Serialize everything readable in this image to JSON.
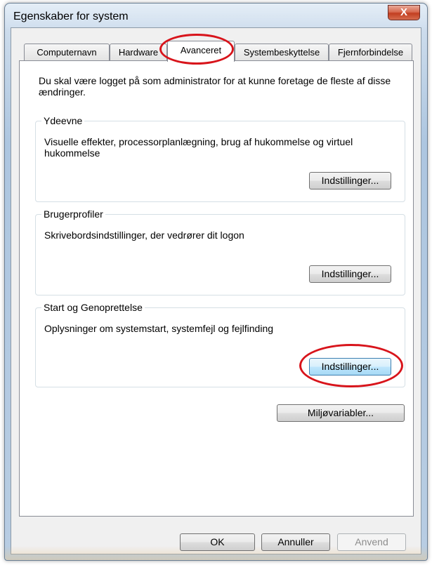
{
  "window": {
    "title": "Egenskaber for system",
    "close_glyph": "X"
  },
  "tabs": [
    {
      "label": "Computernavn"
    },
    {
      "label": "Hardware"
    },
    {
      "label": "Avanceret"
    },
    {
      "label": "Systembeskyttelse"
    },
    {
      "label": "Fjernforbindelse"
    }
  ],
  "active_tab": "Avanceret",
  "intro": "Du skal være logget på som administrator for at kunne foretage de fleste af disse ændringer.",
  "groups": {
    "performance": {
      "title": "Ydeevne",
      "description": "Visuelle effekter, processorplanlægning, brug af hukommelse og virtuel hukommelse",
      "button": "Indstillinger..."
    },
    "profiles": {
      "title": "Brugerprofiler",
      "description": "Skrivebordsindstillinger, der vedrører dit logon",
      "button": "Indstillinger..."
    },
    "startup": {
      "title": "Start og Genoprettelse",
      "description": "Oplysninger om systemstart, systemfejl og fejlfinding",
      "button": "Indstillinger..."
    }
  },
  "env_button": "Miljøvariabler...",
  "footer": {
    "ok": "OK",
    "cancel": "Annuller",
    "apply": "Anvend"
  },
  "colors": {
    "highlight_ellipse": "#d8141b",
    "focus_border": "#3c7fb1"
  }
}
